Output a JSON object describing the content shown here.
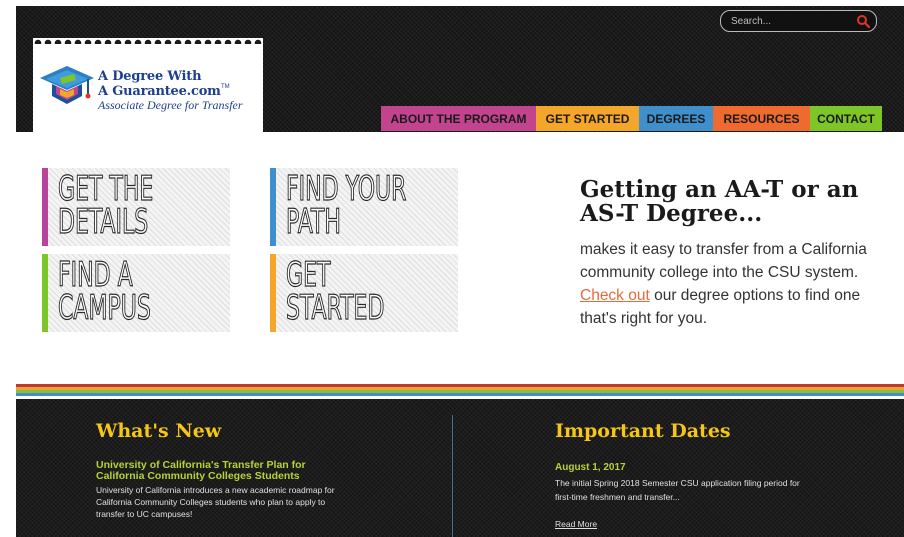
{
  "search": {
    "placeholder": "Search..."
  },
  "logo": {
    "line1": "A Degree With",
    "line2": "A Guarantee.com",
    "trademark": "TM",
    "tagline": "Associate Degree for Transfer"
  },
  "nav": {
    "items": [
      {
        "label": "ABOUT THE PROGRAM",
        "color": "#c2448e"
      },
      {
        "label": "GET STARTED",
        "color": "#f4a62a"
      },
      {
        "label": "DEGREES",
        "color": "#3f8fcd"
      },
      {
        "label": "RESOURCES",
        "color": "#ef6a2e"
      },
      {
        "label": "CONTACT",
        "color": "#7ec527"
      }
    ]
  },
  "tiles": [
    {
      "label": "GET THE DETAILS",
      "line1": "GET THE",
      "line2": "DETAILS",
      "color": "#b9459a"
    },
    {
      "label": "FIND YOUR PATH",
      "line1": "FIND YOUR",
      "line2": "PATH",
      "color": "#3f8fcd"
    },
    {
      "label": "FIND A CAMPUS",
      "line1": "FIND A",
      "line2": "CAMPUS",
      "color": "#7ec527"
    },
    {
      "label": "GET STARTED",
      "line1": "GET",
      "line2": "STARTED",
      "color": "#f4a62a"
    }
  ],
  "promo": {
    "title": "Getting an AA-T or an AS-T Degree...",
    "text_before": "makes it easy to transfer from a California community college into the CSU system. ",
    "link": "Check out",
    "text_after": " our degree options to find one that's right for you."
  },
  "stripes": [
    "#c0392b",
    "#e8a33a",
    "#8bbf3b",
    "#3f8fcd"
  ],
  "whats_new": {
    "title": "What's New",
    "headline": "University of California's Transfer Plan for California Community Colleges Students",
    "body": "University of California introduces a new academic roadmap for California Community Colleges students who plan to apply to transfer to UC campuses!"
  },
  "important_dates": {
    "title": "Important Dates",
    "date": "August 1, 2017",
    "body": "The initial Spring 2018 Semester CSU application filing period for first-time freshmen and transfer...",
    "read_more": "Read More"
  },
  "colors": {
    "header_bg": "#1a1a1a",
    "accent_yellow": "#f5c518",
    "accent_green": "#b5d334",
    "link_orange": "#e36b3a"
  }
}
